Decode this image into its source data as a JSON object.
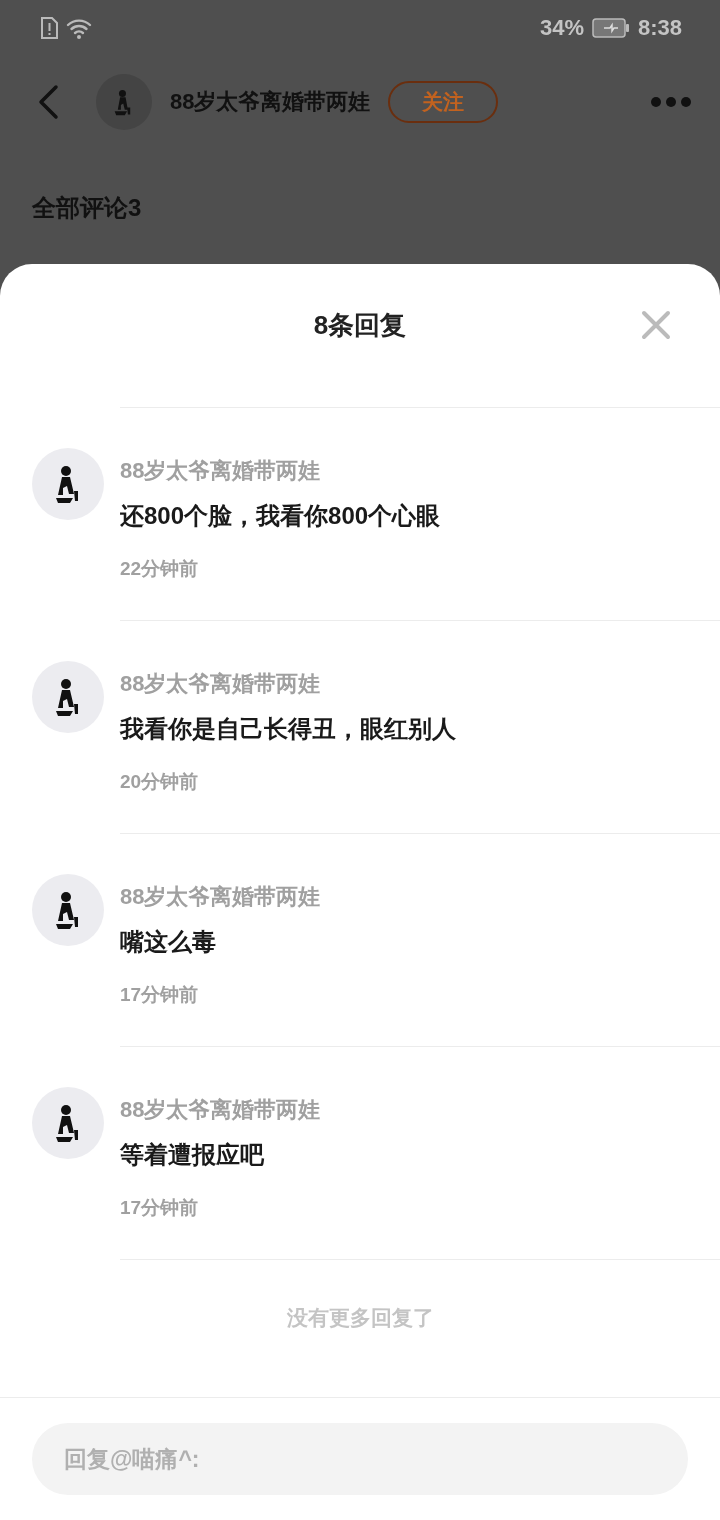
{
  "status_bar": {
    "battery": "34%",
    "time": "8:38"
  },
  "header": {
    "author": "88岁太爷离婚带两娃",
    "follow_label": "关注"
  },
  "comments_title": "全部评论3",
  "sheet": {
    "title": "8条回复",
    "replies": [
      {
        "author": "88岁太爷离婚带两娃",
        "text": "还800个脸，我看你800个心眼",
        "time": "22分钟前"
      },
      {
        "author": "88岁太爷离婚带两娃",
        "text": "我看你是自己长得丑，眼红别人",
        "time": "20分钟前"
      },
      {
        "author": "88岁太爷离婚带两娃",
        "text": "嘴这么毒",
        "time": "17分钟前"
      },
      {
        "author": "88岁太爷离婚带两娃",
        "text": "等着遭报应吧",
        "time": "17分钟前"
      }
    ],
    "end_note": "没有更多回复了",
    "reply_input": {
      "placeholder": "回复@喵痛^:"
    }
  }
}
